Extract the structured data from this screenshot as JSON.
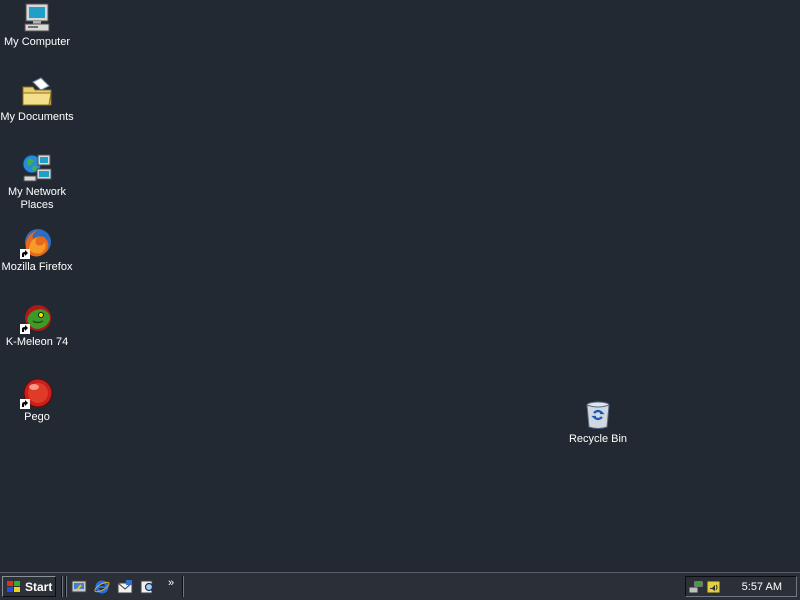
{
  "desktop": {
    "background_color": "#232932",
    "icons": [
      {
        "label": "My Computer",
        "icon": "my-computer-icon"
      },
      {
        "label": "My Documents",
        "icon": "my-documents-icon"
      },
      {
        "label": "My Network Places",
        "icon": "network-places-icon"
      },
      {
        "label": "Mozilla Firefox",
        "icon": "firefox-icon"
      },
      {
        "label": "K-Meleon 74",
        "icon": "k-meleon-icon"
      },
      {
        "label": "Pego",
        "icon": "pego-icon"
      },
      {
        "label": "Recycle Bin",
        "icon": "recycle-bin-icon"
      }
    ]
  },
  "taskbar": {
    "start_label": "Start",
    "quick_launch": [
      "show-desktop-icon",
      "internet-explorer-icon",
      "outlook-express-icon",
      "search-icon"
    ],
    "more_label": "»",
    "tray_icons": [
      "network-icon",
      "volume-icon"
    ],
    "clock": "5:57 AM"
  }
}
